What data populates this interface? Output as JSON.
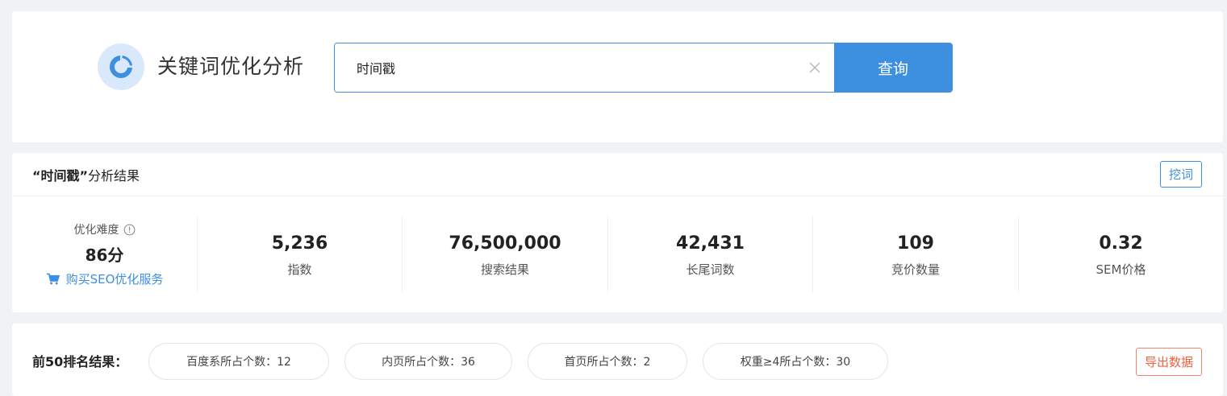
{
  "header": {
    "app_title": "关键词优化分析",
    "logo_icon": "pie-chart-icon",
    "search_value": "时间戳",
    "search_button": "查询"
  },
  "result": {
    "keyword_quoted": "“时间戳”",
    "title_suffix": "分析结果",
    "mine_button": "挖词",
    "difficulty": {
      "label": "优化难度",
      "score": "86分",
      "buy_link": "购买SEO优化服务"
    },
    "metrics": [
      {
        "value": "5,236",
        "label": "指数"
      },
      {
        "value": "76,500,000",
        "label": "搜索结果"
      },
      {
        "value": "42,431",
        "label": "长尾词数"
      },
      {
        "value": "109",
        "label": "竞价数量"
      },
      {
        "value": "0.32",
        "label": "SEM价格"
      }
    ]
  },
  "top50": {
    "label": "前50排名结果：",
    "pills": [
      "百度系所占个数：12",
      "内页所占个数：36",
      "首页所占个数：2",
      "权重≥4所占个数：30"
    ],
    "export_button": "导出数据"
  },
  "colors": {
    "accent": "#3d8fe0",
    "logo_bg": "#d9e8fb",
    "export": "#f06040",
    "page_bg": "#f0f2f5"
  }
}
